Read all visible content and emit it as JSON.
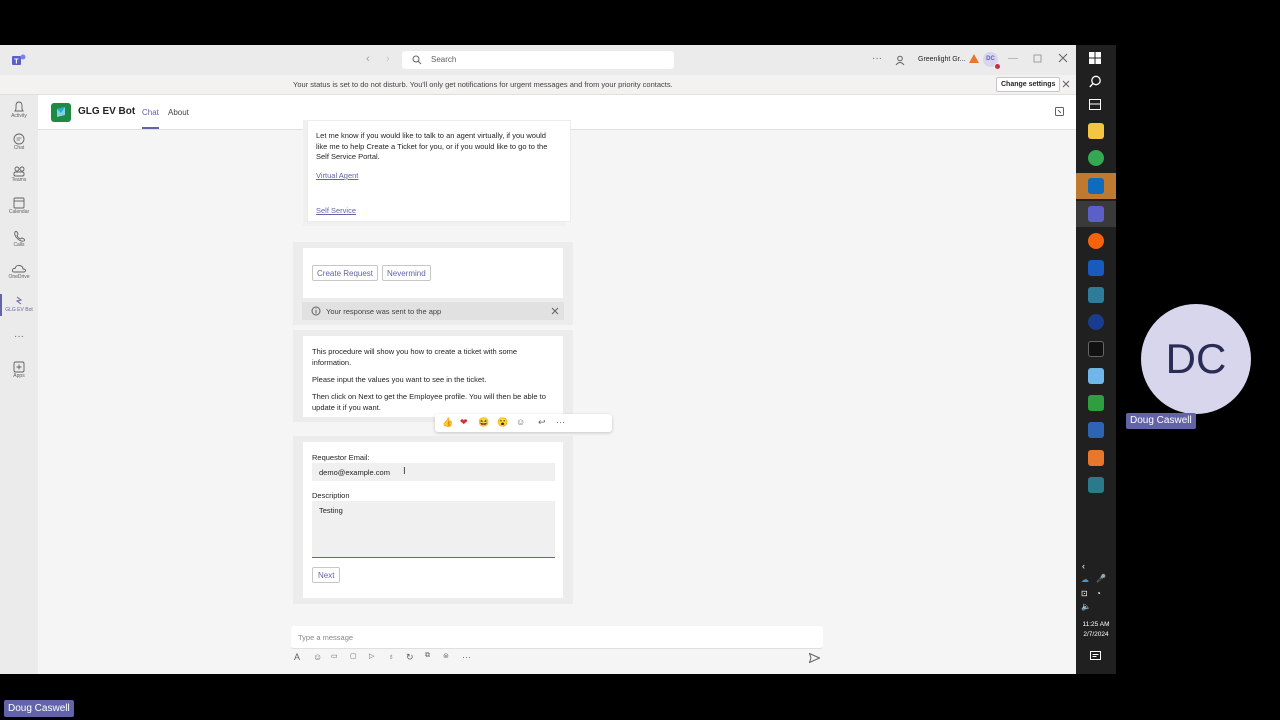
{
  "titlebar": {
    "search_placeholder": "Search",
    "org_name": "Greenlight Gr...",
    "avatar_initials": "DC",
    "more": "···"
  },
  "banner": {
    "message": "Your status is set to do not disturb. You'll only get notifications for urgent messages and from your priority contacts.",
    "change_settings": "Change settings"
  },
  "rail": [
    {
      "label": "Activity",
      "icon": "bell-icon"
    },
    {
      "label": "Chat",
      "icon": "chat-icon"
    },
    {
      "label": "Teams",
      "icon": "teams-icon"
    },
    {
      "label": "Calendar",
      "icon": "calendar-icon"
    },
    {
      "label": "Calls",
      "icon": "phone-icon"
    },
    {
      "label": "OneDrive",
      "icon": "cloud-icon"
    },
    {
      "label": "GLG EV Bot",
      "icon": "bot-icon"
    },
    {
      "label": "···",
      "icon": "more-icon"
    },
    {
      "label": "Apps",
      "icon": "apps-icon"
    }
  ],
  "header": {
    "bot_name": "GLG EV Bot",
    "tab_chat": "Chat",
    "tab_about": "About"
  },
  "card1": {
    "text": "Let me know if you would like to talk to an agent virtually, if you would like me to help Create a Ticket for you, or if you would like to go to the Self Service Portal.",
    "link1": "Virtual Agent",
    "link2": "Self Service"
  },
  "card2": {
    "btn1": "Create Request",
    "btn2": "Nevermind",
    "response_note": "Your response was sent to the app"
  },
  "card3": {
    "p1": "This procedure will show you how to create a ticket with some information.",
    "p2": "Please input the values you want to see in the ticket.",
    "p3": "Then click on Next to get the Employee profile. You will then be able to update it if you want."
  },
  "reactions": [
    "👍",
    "❤",
    "😆",
    "😮",
    "☺",
    "↩",
    "···"
  ],
  "form": {
    "email_label": "Requestor Email:",
    "email_value": "demo@example.com",
    "desc_label": "Description",
    "desc_value": "Testing",
    "next": "Next"
  },
  "compose": {
    "placeholder": "Type a message"
  },
  "taskbar": {
    "time": "11:25 AM",
    "date": "2/7/2024"
  },
  "video": {
    "initials": "DC",
    "name": "Doug Caswell"
  },
  "bottom_name": "Doug Caswell",
  "colors": {
    "accent": "#6264a7",
    "avatar_bg": "#d8d6ec",
    "avatar_text": "#2b2c56"
  }
}
